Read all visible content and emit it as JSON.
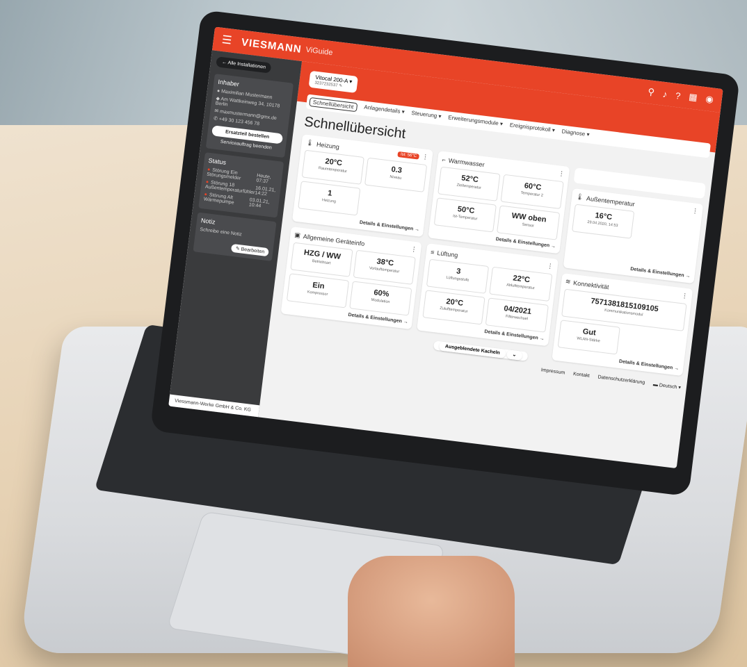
{
  "topbar": {
    "menu_icon": "☰",
    "brand": "VIESMANN",
    "app_name": "ViGuide",
    "icons": [
      "search-icon",
      "bell-icon",
      "help-icon",
      "apps-icon",
      "user-icon"
    ]
  },
  "sidebar": {
    "back_label": "Alle Installationen",
    "owner": {
      "title": "Inhaber",
      "name": "Maximilian Mustermann",
      "address": "Am Wattkeinweg 34, 10178 Berlin",
      "email": "maxmustermann@gmx.de",
      "phone": "+49 30 123 456 78",
      "order_button": "Ersatzteil bestellen",
      "service_link": "Serviceauftrag beenden"
    },
    "status": {
      "title": "Status",
      "items": [
        {
          "label": "Störung",
          "detail": "Ein Störungsmelder",
          "time": "Heute, 07:37"
        },
        {
          "label": "Störung",
          "detail": "18 Außentemperaturfühler",
          "time": "16.01.21, 14:22"
        },
        {
          "label": "Störung",
          "detail": "Alt Wärmepumpe",
          "time": "03.01.21, 10:44"
        }
      ]
    },
    "note": {
      "title": "Notiz",
      "text": "Schreibe eine Notiz",
      "edit_button": "Bearbeiten"
    },
    "footer": "Viessmann-Werke GmbH & Co. KG"
  },
  "main": {
    "device": {
      "name": "Vitocal 200-A",
      "serial": "3237232537"
    },
    "tabs": [
      "Schnellübersicht",
      "Anlagendetails",
      "Steuerung",
      "Erweiterungsmodule",
      "Ereignisprotokoll",
      "Diagnose"
    ],
    "page_title": "Schnellübersicht",
    "heizung": {
      "title": "Heizung",
      "badge": "Ist: 56°C",
      "tiles": [
        {
          "value": "20°C",
          "label": "Raumtemperatur"
        },
        {
          "value": "0.3",
          "label": "Niveau"
        },
        {
          "value": "1",
          "label": "Heizung"
        }
      ],
      "details": "Details & Einstellungen"
    },
    "geraeteinfo": {
      "title": "Allgemeine Geräteinfo",
      "tiles": [
        {
          "value": "HZG / WW",
          "label": "Betriebsart"
        },
        {
          "value": "38°C",
          "label": "Vorlauftemperatur"
        },
        {
          "value": "Ein",
          "label": "Kompressor"
        },
        {
          "value": "60%",
          "label": "Modulation"
        }
      ],
      "details": "Details & Einstellungen"
    },
    "warmwasser": {
      "title": "Warmwasser",
      "tiles": [
        {
          "value": "52°C",
          "label": "Zieltemperatur"
        },
        {
          "value": "60°C",
          "label": "Temperatur 2"
        },
        {
          "value": "50°C",
          "label": "Ist-Temperatur"
        },
        {
          "value": "WW oben",
          "label": "Sensor"
        }
      ],
      "details": "Details & Einstellungen"
    },
    "lueftung": {
      "title": "Lüftung",
      "tiles": [
        {
          "value": "3",
          "label": "Lüftungsstufe"
        },
        {
          "value": "22°C",
          "label": "Ablufttemperatur"
        },
        {
          "value": "20°C",
          "label": "Zulufttemperatur"
        },
        {
          "value": "04/2021",
          "label": "Filterwechsel"
        }
      ],
      "details": "Details & Einstellungen"
    },
    "aussentemperatur": {
      "title": "Außentemperatur",
      "tiles": [
        {
          "value": "16°C",
          "label": "29.04.2020, 14:53"
        }
      ],
      "details": "Details & Einstellungen"
    },
    "konnektivitaet": {
      "title": "Konnektivität",
      "tiles": [
        {
          "value": "7571381815109105",
          "label": "Kommunikationsmodul"
        },
        {
          "value": "Gut",
          "label": "WLAN-Stärke"
        }
      ],
      "details": "Details & Einstellungen"
    },
    "hidden_tiles": "Ausgeblendete Kacheln",
    "footer": {
      "links": [
        "Impressum",
        "Kontakt",
        "Datenschutzerklärung"
      ],
      "language": "Deutsch"
    }
  }
}
